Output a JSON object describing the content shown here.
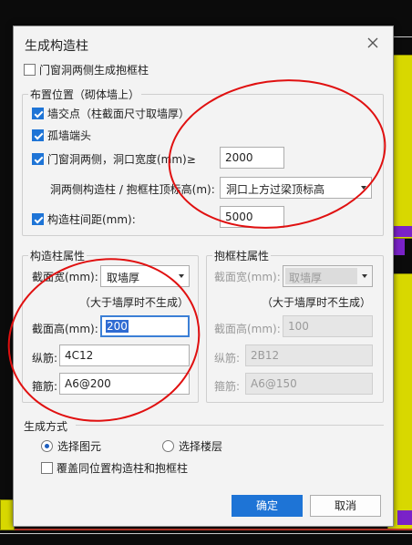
{
  "dialog": {
    "title": "生成构造柱",
    "door_window_frame_label": "门窗洞两侧生成抱框柱",
    "door_window_frame_checked": false
  },
  "layout_group": {
    "title": "布置位置（砌体墙上）",
    "wall_intersection_label": "墙交点（柱截面尺寸取墙厚）",
    "wall_intersection_checked": true,
    "isolated_wall_end_label": "孤墙端头",
    "isolated_wall_end_checked": true,
    "door_window_sides_label": "门窗洞两侧，洞口宽度(mm)≥",
    "door_window_sides_checked": true,
    "opening_width_value": "2000",
    "top_elevation_label": "洞两侧构造柱 / 抱框柱顶标高(m):",
    "top_elevation_value": "洞口上方过梁顶标高",
    "spacing_label": "构造柱间距(mm):",
    "spacing_checked": true,
    "spacing_value": "5000"
  },
  "column_props": {
    "title": "构造柱属性",
    "width_label": "截面宽(mm):",
    "width_value": "取墙厚",
    "hint": "（大于墙厚时不生成）",
    "height_label": "截面高(mm):",
    "height_value": "200",
    "longitudinal_label": "纵筋:",
    "longitudinal_value": "4C12",
    "stirrup_label": "箍筋:",
    "stirrup_value": "A6@200"
  },
  "frame_props": {
    "title": "抱框柱属性",
    "width_label": "截面宽(mm):",
    "width_value": "取墙厚",
    "hint": "（大于墙厚时不生成）",
    "height_label": "截面高(mm):",
    "height_value": "100",
    "longitudinal_label": "纵筋:",
    "longitudinal_value": "2B12",
    "stirrup_label": "箍筋:",
    "stirrup_value": "A6@150"
  },
  "generate_mode": {
    "title": "生成方式",
    "option_select_element": "选择图元",
    "option_select_floor": "选择楼层",
    "selected": "选择图元",
    "overwrite_label": "覆盖同位置构造柱和抱框柱",
    "overwrite_checked": false
  },
  "buttons": {
    "ok": "确定",
    "cancel": "取消"
  },
  "colors": {
    "accent": "#1e74d6",
    "annotation": "#e01010"
  }
}
